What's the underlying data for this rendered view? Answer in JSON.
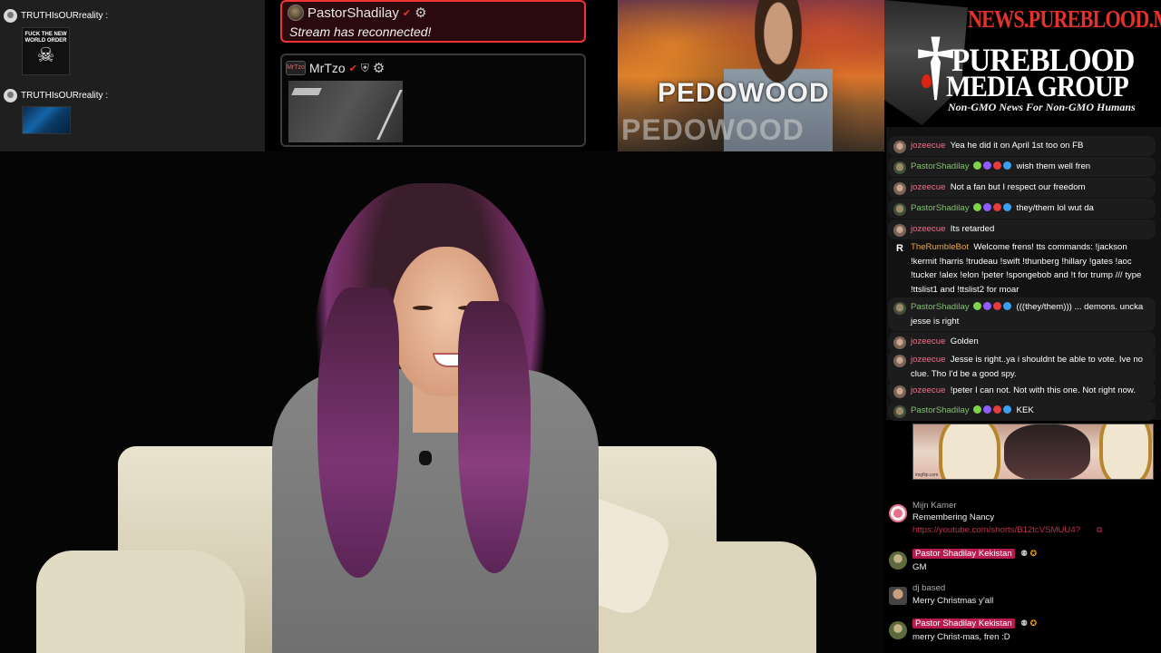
{
  "left_chat": {
    "messages": [
      {
        "user": "TRUTHIsOURreality :",
        "image_caption": "FUCK THE NEW WORLD ORDER"
      },
      {
        "user": "TRUTHIsOURreality :"
      }
    ]
  },
  "alerts": {
    "reconnect": {
      "user": "PastorShadilay",
      "message": "Stream has reconnected!"
    },
    "second": {
      "user": "MrTzo",
      "logo_text": "MrTzo"
    }
  },
  "promo": {
    "sign_text": "PEDOWOOD"
  },
  "logo": {
    "site": "NEWS.PUREBLOOD.MEDIA",
    "line1": "PUREBLOOD",
    "line2": "MEDIA GROUP",
    "tagline": "Non-GMO News For Non-GMO Humans"
  },
  "rumble_chat": {
    "messages": [
      {
        "user": "jozeecue",
        "text": "Yea he did it on April 1st too on FB"
      },
      {
        "user": "PastorShadilay",
        "text": "wish them well fren"
      },
      {
        "user": "jozeecue",
        "text": "Not a fan but I respect our freedom"
      },
      {
        "user": "PastorShadilay",
        "text": "they/them lol wut da"
      },
      {
        "user": "jozeecue",
        "text": "Its retarded"
      },
      {
        "user": "TheRumbleBot",
        "text": "Welcome frens! tts commands: !jackson !kermit !harris !trudeau !swift !thunberg !hillary !gates !aoc !tucker !alex !elon !peter !spongebob and !t for trump /// type !ttslist1 and !ttslist2 for moar"
      },
      {
        "user": "PastorShadilay",
        "text": "(((they/them))) ... demons. uncka jesse is right"
      },
      {
        "user": "jozeecue",
        "text": "Golden"
      },
      {
        "user": "jozeecue",
        "text": "Jesse is right..ya i shouldnt be able to vote. Ive no clue. Tho I'd be a good spy."
      },
      {
        "user": "jozeecue",
        "text": "!peter I can not. Not with this one. Not right now."
      },
      {
        "user": "PastorShadilay",
        "text": "KEK"
      }
    ]
  },
  "gif": {
    "watermark": "imgflip.com"
  },
  "bottom_chat": {
    "messages": [
      {
        "user": "Mijn Kamer",
        "text": "Remembering Nancy",
        "link": "https://youtube.com/shorts/B12tcVSMUU4?"
      },
      {
        "user": "Pastor Shadilay Kekistan",
        "text": "GM"
      },
      {
        "user": "dj based",
        "text": "Merry Christmas y'all"
      },
      {
        "user": "Pastor Shadilay Kekistan",
        "text": "merry Christ-mas, fren :D"
      }
    ]
  },
  "colors": {
    "jozeecue": "#ee6f8c",
    "pastor": "#7fc46a",
    "bot": "#e8a64a",
    "alert_border": "#ee3333",
    "highlight_name": "#b71b4d"
  }
}
